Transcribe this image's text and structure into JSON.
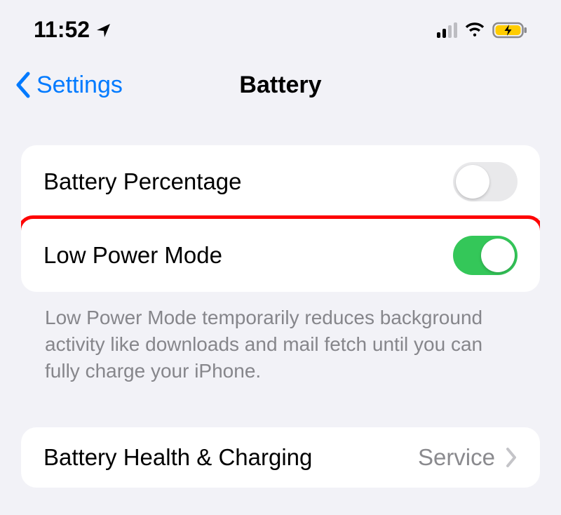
{
  "status": {
    "time": "11:52"
  },
  "nav": {
    "back_label": "Settings",
    "title": "Battery"
  },
  "group1": {
    "row1_label": "Battery Percentage",
    "row1_on": false,
    "row2_label": "Low Power Mode",
    "row2_on": true,
    "footer": "Low Power Mode temporarily reduces background activity like downloads and mail fetch until you can fully charge your iPhone."
  },
  "group2": {
    "row1_label": "Battery Health & Charging",
    "row1_detail": "Service"
  },
  "colors": {
    "link": "#007aff",
    "toggle_on": "#34c759",
    "highlight": "#fe0504",
    "battery_fill": "#ffcc00"
  }
}
